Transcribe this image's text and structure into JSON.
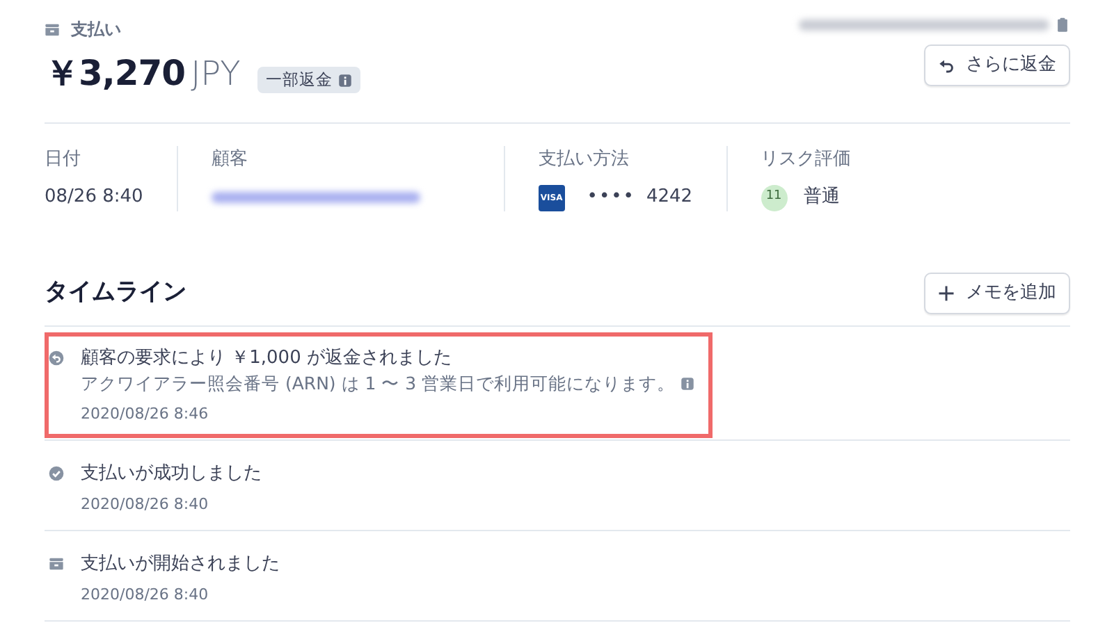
{
  "header": {
    "label": "支払い",
    "amount": "￥3,270",
    "currency": "JPY",
    "badge": "一部返金",
    "id_blurred": true
  },
  "refund_button": "さらに返金",
  "details": [
    {
      "kind": "text",
      "label": "日付",
      "value": "08/26 8:40"
    },
    {
      "kind": "blurred",
      "label": "顧客"
    },
    {
      "kind": "card",
      "label": "支払い方法",
      "card_brand": "VISA",
      "dots": "••••",
      "last4": "4242"
    },
    {
      "kind": "risk",
      "label": "リスク評価",
      "score": "11",
      "value": "普通",
      "color": "#cdeccd"
    }
  ],
  "timeline": {
    "title": "タイムライン",
    "add_button": "メモを追加",
    "items": [
      {
        "kind": "refund",
        "title": "顧客の要求により ￥1,000 が返金されました",
        "note": "アクワイアラー照会番号 (ARN) は 1 〜 3 営業日で利用可能になります。",
        "time": "2020/08/26 8:46",
        "highlighted": true
      },
      {
        "kind": "success",
        "title": "支払いが成功しました",
        "time": "2020/08/26 8:40",
        "highlighted": false
      },
      {
        "kind": "payment",
        "title": "支払いが開始されました",
        "time": "2020/08/26 8:40",
        "highlighted": false
      }
    ]
  }
}
